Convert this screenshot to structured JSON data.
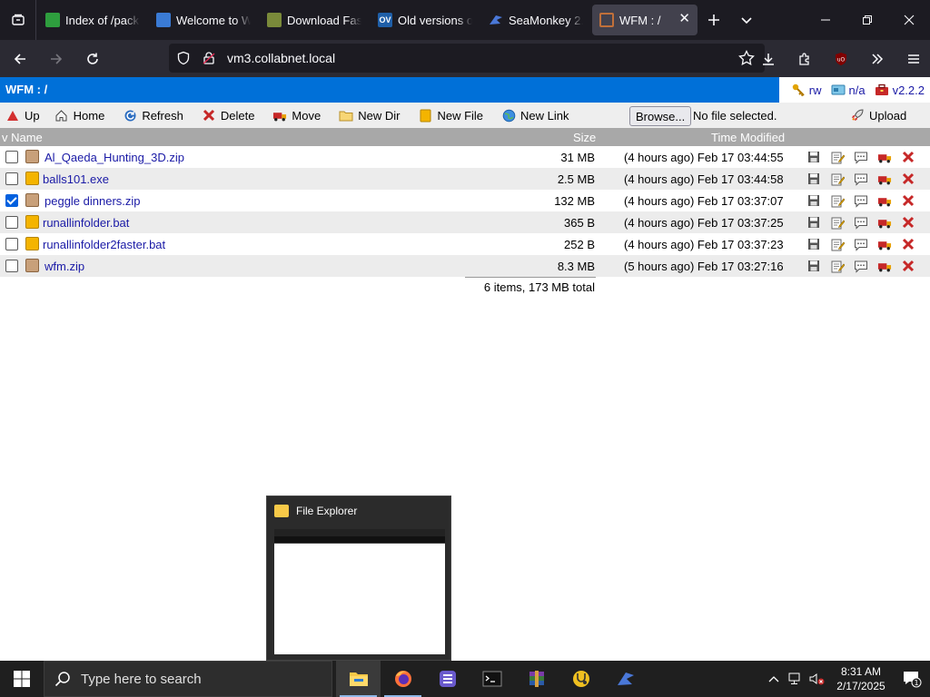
{
  "colors": {
    "accent": "#0070d8",
    "link": "#1a1aa6",
    "tab_bg": "#1c1b22",
    "nav_bg": "#2b2a33",
    "taskbar_bg": "#1f1f1f"
  },
  "browser": {
    "tabs": [
      {
        "label": "Index of /pack",
        "icon": "leaf-favicon",
        "active": false
      },
      {
        "label": "Welcome to W",
        "icon": "wordpress-favicon",
        "active": false
      },
      {
        "label": "Download Fas",
        "icon": "download-favicon",
        "active": false
      },
      {
        "label": "Old versions o",
        "icon": "ov-favicon",
        "active": false
      },
      {
        "label": "SeaMonkey 2.",
        "icon": "seamonkey-favicon",
        "active": false
      },
      {
        "label": "WFM : /",
        "icon": "wfm-favicon",
        "active": true
      }
    ],
    "url": "vm3.collabnet.local"
  },
  "wfm": {
    "title": "WFM : /",
    "info": {
      "mode": "rw",
      "status": "n/a",
      "version": "v2.2.2"
    },
    "toolbar": {
      "up": "Up",
      "home": "Home",
      "refresh": "Refresh",
      "delete": "Delete",
      "move": "Move",
      "new_dir": "New Dir",
      "new_file": "New File",
      "new_link": "New Link",
      "browse": "Browse...",
      "no_file": "No file selected.",
      "upload": "Upload"
    },
    "columns": {
      "name": "v Name",
      "size": "Size",
      "modified": "Time Modified"
    },
    "files": [
      {
        "name": "Al_Qaeda_Hunting_3D.zip",
        "type": "zip",
        "size": "31 MB",
        "modified": "(4 hours ago) Feb 17 03:44:55",
        "checked": false
      },
      {
        "name": "balls101.exe",
        "type": "exe",
        "size": "2.5 MB",
        "modified": "(4 hours ago) Feb 17 03:44:58",
        "checked": false
      },
      {
        "name": "peggle dinners.zip",
        "type": "zip",
        "size": "132 MB",
        "modified": "(4 hours ago) Feb 17 03:37:07",
        "checked": true
      },
      {
        "name": "runallinfolder.bat",
        "type": "exe",
        "size": "365 B",
        "modified": "(4 hours ago) Feb 17 03:37:25",
        "checked": false
      },
      {
        "name": "runallinfolder2faster.bat",
        "type": "exe",
        "size": "252 B",
        "modified": "(4 hours ago) Feb 17 03:37:23",
        "checked": false
      },
      {
        "name": "wfm.zip",
        "type": "zip",
        "size": "8.3 MB",
        "modified": "(5 hours ago) Feb 17 03:27:16",
        "checked": false
      }
    ],
    "total": "6 items, 173 MB total"
  },
  "thumbnail": {
    "title": "File Explorer"
  },
  "taskbar": {
    "search_placeholder": "Type here to search",
    "time": "8:31 AM",
    "date": "2/17/2025",
    "notification_count": "1"
  }
}
